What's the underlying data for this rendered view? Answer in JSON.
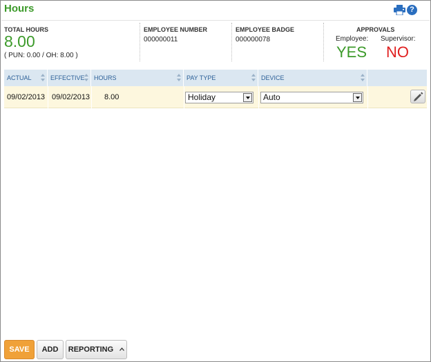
{
  "page": {
    "title": "Hours"
  },
  "summary": {
    "total_hours_label": "TOTAL HOURS",
    "total_hours_value": "8.00",
    "total_hours_breakdown": "( PUN: 0.00 / OH: 8.00 )",
    "employee_number_label": "EMPLOYEE NUMBER",
    "employee_number_value": "000000011",
    "employee_badge_label": "EMPLOYEE BADGE",
    "employee_badge_value": "000000078",
    "approvals_label": "APPROVALS",
    "employee_label": "Employee:",
    "employee_status": "YES",
    "supervisor_label": "Supervisor:",
    "supervisor_status": "NO"
  },
  "table": {
    "columns": [
      "ACTUAL",
      "EFFECTIVE",
      "HOURS",
      "PAY TYPE",
      "DEVICE"
    ],
    "rows": [
      {
        "actual": "09/02/2013",
        "effective": "09/02/2013",
        "hours": "8.00",
        "pay_type": "Holiday",
        "device": "Auto"
      }
    ]
  },
  "footer": {
    "save_label": "SAVE",
    "add_label": "ADD",
    "reporting_label": "REPORTING"
  },
  "icons": {
    "print": "print-icon",
    "help": "help-icon",
    "edit": "pencil-icon"
  },
  "colors": {
    "accent_green": "#3c9a2a",
    "no_red": "#e02020",
    "save_orange": "#f0a138",
    "header_blue": "#2b5f97"
  }
}
